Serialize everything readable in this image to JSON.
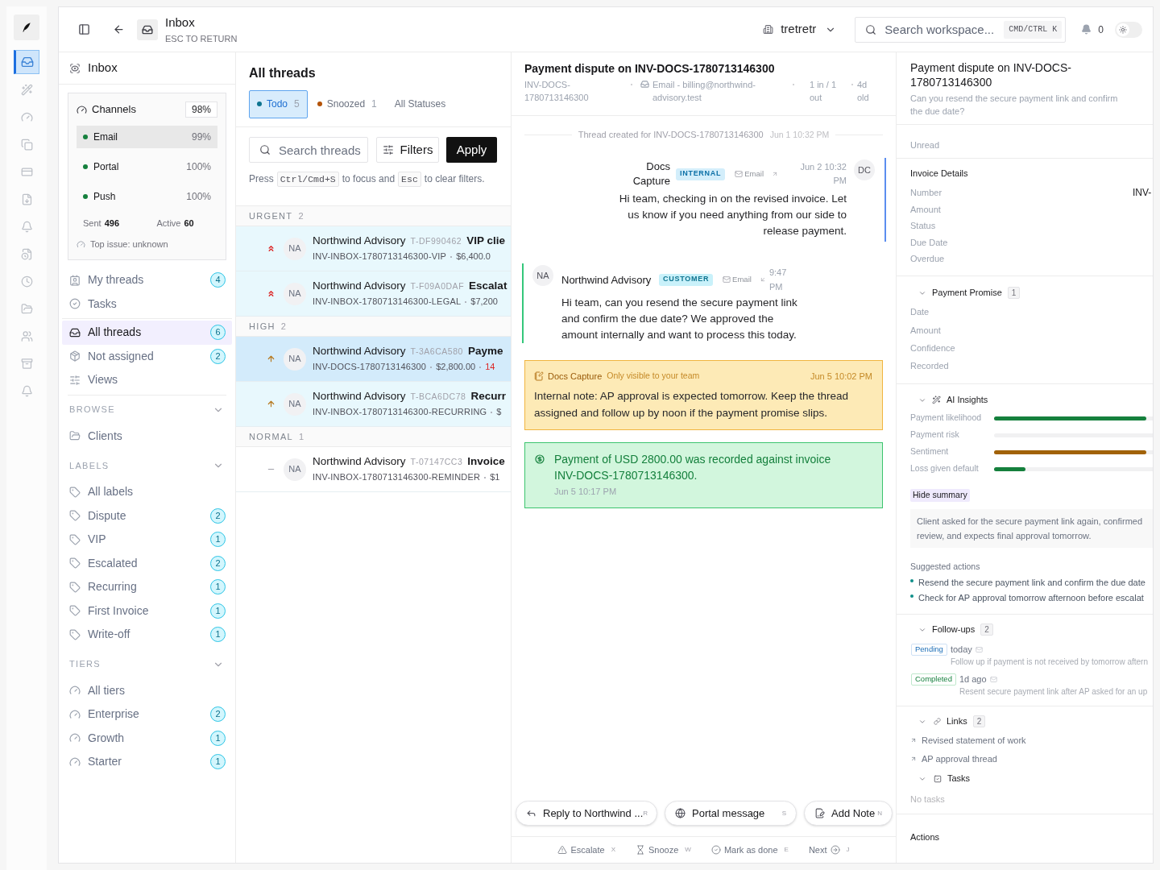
{
  "rail": {
    "items": [
      {
        "kind": "inbox",
        "selected": true
      },
      {
        "kind": "wand",
        "selected": false
      },
      {
        "kind": "gauge",
        "selected": false
      },
      {
        "kind": "copy",
        "selected": false
      },
      {
        "kind": "card",
        "selected": false
      },
      {
        "kind": "filedown",
        "selected": false
      },
      {
        "kind": "bell",
        "selected": false
      },
      {
        "kind": "fileclock",
        "selected": false
      },
      {
        "kind": "clock",
        "selected": false
      },
      {
        "kind": "folder",
        "selected": false
      },
      {
        "kind": "users",
        "selected": false
      },
      {
        "kind": "archive",
        "selected": false
      },
      {
        "kind": "bell",
        "selected": false
      }
    ]
  },
  "topbar": {
    "title": "Inbox",
    "subtitle": "ESC TO RETURN",
    "workspace": "tretretr",
    "search": {
      "placeholder": "Search workspace...",
      "shortcut": "CMD/CTRL K"
    },
    "notifications": "0",
    "dark_mode": false
  },
  "nav": {
    "title": "Inbox",
    "channels": {
      "title": "Channels",
      "score": "98%",
      "items": [
        {
          "name": "Email",
          "value": "99%",
          "selected": true
        },
        {
          "name": "Portal",
          "value": "100%",
          "selected": false
        },
        {
          "name": "Push",
          "value": "100%",
          "selected": false
        }
      ],
      "stats": [
        {
          "label": "Sent",
          "value": "496"
        },
        {
          "label": "Active",
          "value": "60"
        }
      ],
      "top_issue": "Top issue: unknown"
    },
    "groups": [
      {
        "items": [
          {
            "kind": "mine",
            "label": "My threads",
            "count": "4",
            "selected": false
          },
          {
            "kind": "tasks",
            "label": "Tasks",
            "selected": false
          }
        ]
      },
      {
        "items": [
          {
            "kind": "all",
            "label": "All threads",
            "count": "6",
            "selected": true
          },
          {
            "kind": "unassigned",
            "label": "Not assigned",
            "count": "2",
            "selected": false
          },
          {
            "kind": "views",
            "label": "Views",
            "selected": false
          }
        ]
      }
    ],
    "sections": [
      {
        "title": "BROWSE",
        "expanded": true,
        "items": [
          {
            "kind": "folder",
            "label": "Clients",
            "selected": false
          }
        ]
      },
      {
        "title": "LABELS",
        "expanded": true,
        "items": [
          {
            "kind": "label",
            "label": "All labels",
            "selected": false
          },
          {
            "kind": "label",
            "label": "Dispute",
            "count": "2",
            "selected": false
          },
          {
            "kind": "label",
            "label": "VIP",
            "count": "1",
            "selected": false
          },
          {
            "kind": "label",
            "label": "Escalated",
            "count": "2",
            "selected": false
          },
          {
            "kind": "label",
            "label": "Recurring",
            "count": "1",
            "selected": false
          },
          {
            "kind": "label",
            "label": "First Invoice",
            "count": "1",
            "selected": false
          },
          {
            "kind": "label",
            "label": "Write-off",
            "count": "1",
            "selected": false
          }
        ]
      },
      {
        "title": "TIERS",
        "expanded": true,
        "items": [
          {
            "kind": "tier",
            "label": "All tiers",
            "selected": false
          },
          {
            "kind": "tier",
            "label": "Enterprise",
            "count": "2",
            "selected": false
          },
          {
            "kind": "tier",
            "label": "Growth",
            "count": "1",
            "selected": false
          },
          {
            "kind": "tier",
            "label": "Starter",
            "count": "1",
            "selected": false
          }
        ]
      }
    ]
  },
  "threads": {
    "title": "All threads",
    "tabs": [
      {
        "label": "Todo",
        "count": "5",
        "selected": true,
        "color": "#0e7490"
      },
      {
        "label": "Snoozed",
        "count": "1",
        "selected": false,
        "color": "#b45309"
      },
      {
        "label": "All Statuses",
        "selected": false
      }
    ],
    "search": {
      "placeholder": "Search threads"
    },
    "filters_button": "Filters",
    "apply_button": "Apply",
    "hint": [
      {
        "kind": "text",
        "text": "Press"
      },
      {
        "kind": "key",
        "text": "Ctrl/Cmd+S"
      },
      {
        "kind": "text",
        "text": "to focus and"
      },
      {
        "kind": "key",
        "text": "Esc"
      },
      {
        "kind": "text",
        "text": "to clear filters."
      }
    ],
    "groups": [
      {
        "title": "URGENT",
        "count": "2",
        "rows": [
          {
            "kind": "urgent",
            "initials": "NA",
            "name": "Northwind Advisory",
            "ref": "T-DF990462",
            "subject": "VIP clie",
            "invoice": "INV-INBOX-1780713146300-VIP",
            "amount": "$6,400.0",
            "selected": false
          },
          {
            "kind": "urgent",
            "initials": "NA",
            "name": "Northwind Advisory",
            "ref": "T-F09A0DAF",
            "subject": "Escalat",
            "invoice": "INV-INBOX-1780713146300-LEGAL",
            "amount": "$7,200",
            "selected": false
          }
        ]
      },
      {
        "title": "HIGH",
        "count": "2",
        "rows": [
          {
            "kind": "high",
            "initials": "NA",
            "name": "Northwind Advisory",
            "ref": "T-3A6CA580",
            "subject": "Payme",
            "invoice": "INV-DOCS-1780713146300",
            "amount": "$2,800.00",
            "overdue": "14",
            "selected": true
          },
          {
            "kind": "high",
            "initials": "NA",
            "name": "Northwind Advisory",
            "ref": "T-BCA6DC78",
            "subject": "Recurr",
            "invoice": "INV-INBOX-1780713146300-RECURRING",
            "amount": "$",
            "selected": false
          }
        ]
      },
      {
        "title": "NORMAL",
        "count": "1",
        "rows": [
          {
            "kind": "normal",
            "initials": "NA",
            "name": "Northwind Advisory",
            "ref": "T-07147CC3",
            "subject": "Invoice",
            "invoice": "INV-INBOX-1780713146300-REMINDER",
            "amount": "$1",
            "selected": false
          }
        ]
      }
    ]
  },
  "conversation": {
    "title": "Payment dispute on INV-DOCS-1780713146300",
    "meta": {
      "invoice": "INV-DOCS-1780713146300",
      "channel": "Email - billing@northwind-advisory.test",
      "counts": "1 in / 1 out",
      "age": "4d old"
    },
    "created": {
      "text": "Thread created for INV-DOCS-1780713146300",
      "time": "Jun 1 10:32 PM"
    },
    "messages": [
      {
        "kind": "outbound",
        "initials": "DC",
        "author": "Docs Capture",
        "badge": "INTERNAL",
        "channel": "Email",
        "time": "Jun 2 10:32 PM",
        "body": "Hi team, checking in on the revised invoice. Let us know if you need anything from our side to release payment."
      },
      {
        "kind": "inbound",
        "initials": "NA",
        "author": "Northwind Advisory",
        "badge": "CUSTOMER",
        "channel": "Email",
        "time": "9:47 PM",
        "body": "Hi team, can you resend the secure payment link and confirm the due date? We approved the amount internally and want to process this today."
      }
    ],
    "note": {
      "author": "Docs Capture",
      "visibility": "Only visible to your team",
      "time": "Jun 5 10:02 PM",
      "body": "Internal note: AP approval is expected tomorrow. Keep the thread assigned and follow up by noon if the payment promise slips."
    },
    "payment": {
      "text": "Payment of USD 2800.00 was recorded against invoice INV-DOCS-1780713146300.",
      "time": "Jun 5 10:17 PM"
    },
    "composer": [
      {
        "kind": "reply",
        "label": "Reply to Northwind ...",
        "shortcut": "R"
      },
      {
        "kind": "portal",
        "label": "Portal message",
        "shortcut": "S"
      },
      {
        "kind": "note",
        "label": "Add Note",
        "shortcut": "N"
      }
    ],
    "actions": [
      {
        "kind": "escalate",
        "label": "Escalate",
        "shortcut": "X"
      },
      {
        "kind": "snooze",
        "label": "Snooze",
        "shortcut": "W"
      },
      {
        "kind": "done",
        "label": "Mark as done",
        "shortcut": "E"
      },
      {
        "kind": "next",
        "label": "Next",
        "shortcut": "J"
      }
    ]
  },
  "details": {
    "title": "Payment dispute on INV-DOCS-1780713146300",
    "subtitle": "Can you resend the secure payment link and confirm the due date?",
    "status": "Unread",
    "invoice": {
      "title": "Invoice Details",
      "fields": [
        {
          "label": "Number",
          "value": "INV-"
        },
        {
          "label": "Amount"
        },
        {
          "label": "Status"
        },
        {
          "label": "Due Date"
        },
        {
          "label": "Overdue"
        }
      ]
    },
    "promise": {
      "title": "Payment Promise",
      "count": "1",
      "expanded": true,
      "fields": [
        {
          "label": "Date"
        },
        {
          "label": "Amount"
        },
        {
          "label": "Confidence"
        },
        {
          "label": "Recorded"
        }
      ]
    },
    "insights": {
      "title": "AI Insights",
      "expanded": true,
      "metrics": [
        {
          "label": "Payment likelihood",
          "level": 0.96,
          "color": "#15803d"
        },
        {
          "label": "Payment risk"
        },
        {
          "label": "Sentiment",
          "level": 0.96,
          "color": "#a16207"
        },
        {
          "label": "Loss given default",
          "level": 0.2,
          "color": "#15803d"
        }
      ],
      "summary_toggle": "Hide summary",
      "summary": "Client asked for the secure payment link again, confirmed review, and expects final approval tomorrow.",
      "suggested_title": "Suggested actions",
      "suggested": [
        "Resend the secure payment link and confirm the due date",
        "Check for AP approval tomorrow afternoon before escalat"
      ]
    },
    "followups": {
      "title": "Follow-ups",
      "count": "2",
      "expanded": true,
      "items": [
        {
          "kind": "pending",
          "status": "Pending",
          "when": "today",
          "text": "Follow up if payment is not received by tomorrow aftern"
        },
        {
          "kind": "completed",
          "status": "Completed",
          "when": "1d ago",
          "text": "Resent secure payment link after AP asked for an up"
        }
      ]
    },
    "links": {
      "title": "Links",
      "count": "2",
      "expanded": true,
      "items": [
        {
          "label": "Revised statement of work"
        },
        {
          "label": "AP approval thread"
        }
      ]
    },
    "tasks": {
      "title": "Tasks",
      "expanded": true,
      "empty": "No tasks"
    },
    "actions_title": "Actions"
  }
}
